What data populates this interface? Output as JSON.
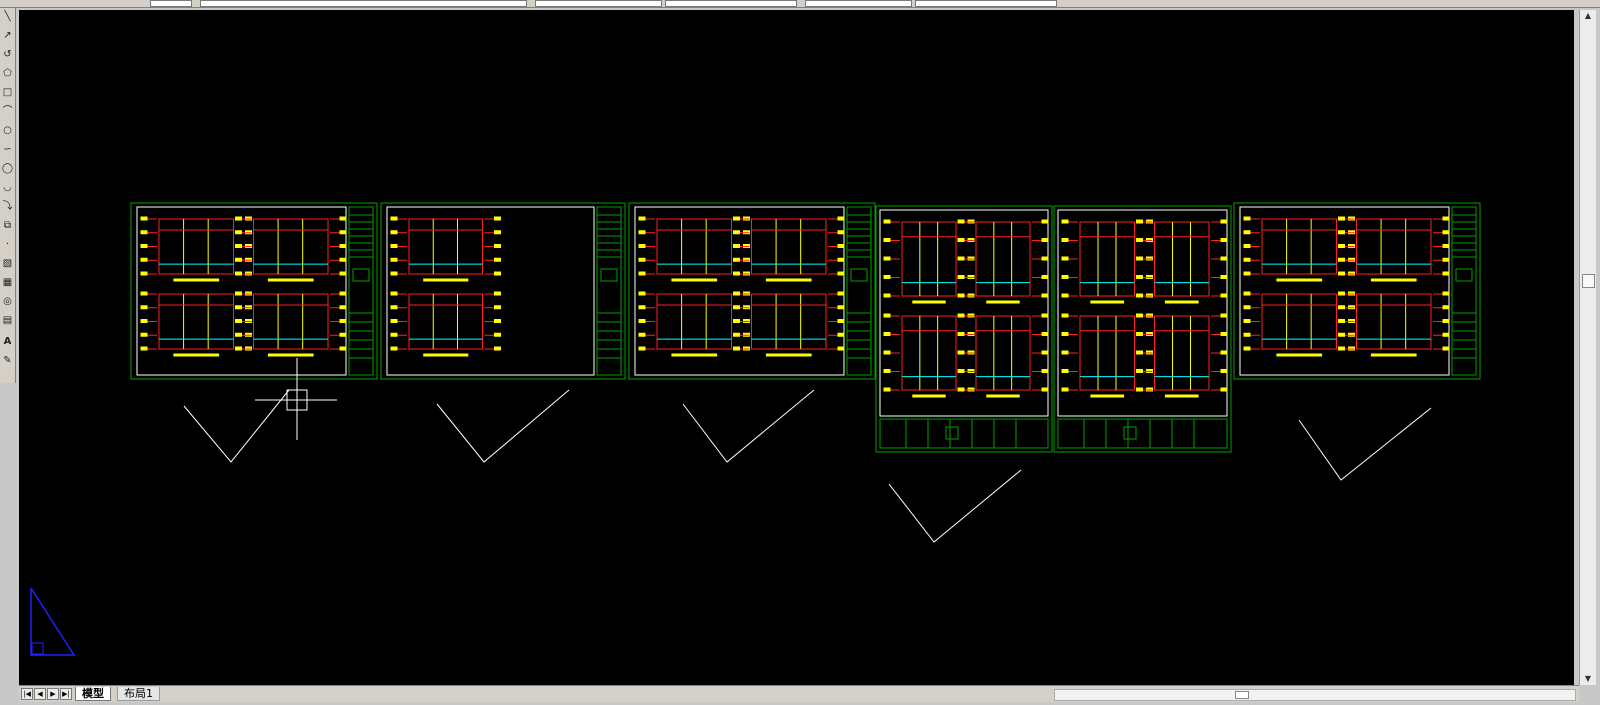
{
  "app": {
    "layout_tabs": [
      {
        "label": "模型",
        "active": true
      },
      {
        "label": "布局1",
        "active": false
      }
    ]
  },
  "colors": {
    "canvas_bg": "#000000",
    "sheet_border": "#00a000",
    "drawing_frame": "#ffffff",
    "dimension": "#ff2020",
    "label": "#ffff00",
    "accent": "#00ffff"
  },
  "icons": {
    "left_toolbar": [
      "line-icon",
      "arrow-icon",
      "undo-arc-icon",
      "polygon-icon",
      "rectangle-icon",
      "arc-icon",
      "circle-icon",
      "spline-icon",
      "ellipse-icon",
      "ellipse-arc-icon",
      "insert-block-icon",
      "make-block-icon",
      "point-icon",
      "hatch-icon",
      "gradient-icon",
      "region-icon",
      "table-icon",
      "text-icon",
      "add-selected-icon"
    ],
    "crosshair": "crosshair-cursor-icon",
    "ucs": "ucs-icon"
  }
}
